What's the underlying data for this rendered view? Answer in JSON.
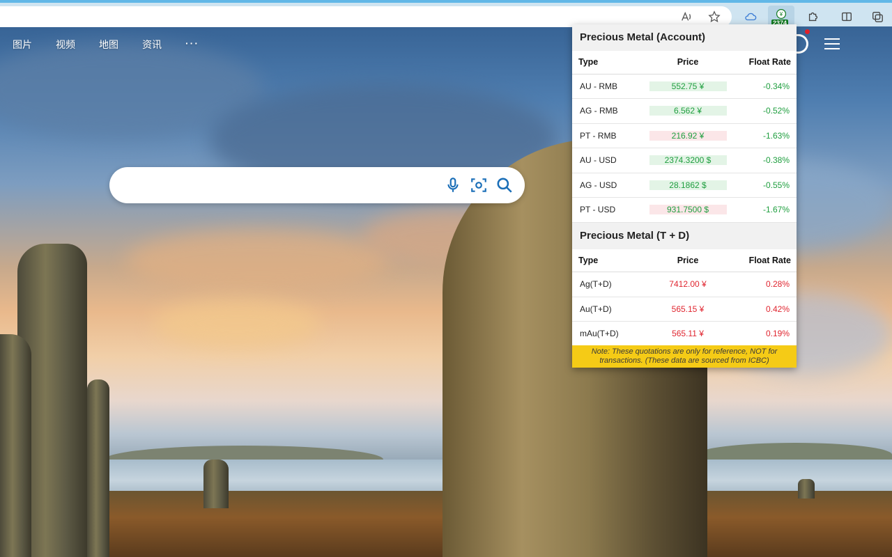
{
  "browser": {
    "toolbar": {
      "read_aloud_icon": "read-aloud-icon",
      "favorite_icon": "star-icon",
      "extension_badge": "2374"
    }
  },
  "page": {
    "nav": [
      "图片",
      "视频",
      "地图",
      "资讯",
      "···"
    ],
    "search": {
      "placeholder": ""
    }
  },
  "popup": {
    "account": {
      "title": "Precious Metal (Account)",
      "headers": {
        "type": "Type",
        "price": "Price",
        "rate": "Float Rate"
      },
      "rows": [
        {
          "type": "AU - RMB",
          "price": "552.75 ¥",
          "rate": "-0.34%",
          "trend": "up"
        },
        {
          "type": "AG - RMB",
          "price": "6.562 ¥",
          "rate": "-0.52%",
          "trend": "up"
        },
        {
          "type": "PT - RMB",
          "price": "216.92 ¥",
          "rate": "-1.63%",
          "trend": "down"
        },
        {
          "type": "AU - USD",
          "price": "2374.3200 $",
          "rate": "-0.38%",
          "trend": "up"
        },
        {
          "type": "AG - USD",
          "price": "28.1862 $",
          "rate": "-0.55%",
          "trend": "up"
        },
        {
          "type": "PT - USD",
          "price": "931.7500 $",
          "rate": "-1.67%",
          "trend": "down"
        }
      ]
    },
    "td": {
      "title": "Precious Metal (T + D)",
      "headers": {
        "type": "Type",
        "price": "Price",
        "rate": "Float Rate"
      },
      "rows": [
        {
          "type": "Ag(T+D)",
          "price": "7412.00 ¥",
          "rate": "0.28%"
        },
        {
          "type": "Au(T+D)",
          "price": "565.15 ¥",
          "rate": "0.42%"
        },
        {
          "type": "mAu(T+D)",
          "price": "565.11 ¥",
          "rate": "0.19%"
        }
      ]
    },
    "note": "Note: These quotations are only for reference, NOT for transactions. (These data are sourced from ICBC)"
  },
  "colors": {
    "gain": "#e0252f",
    "loss": "#1e9e3e",
    "note_bg": "#f5cb16"
  }
}
